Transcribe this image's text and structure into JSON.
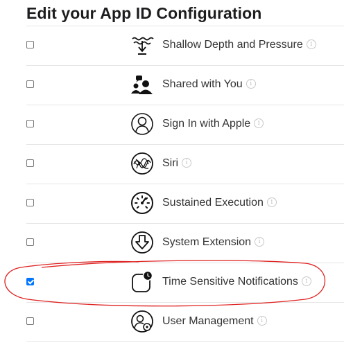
{
  "page_title": "Edit your App ID Configuration",
  "info_glyph": "i",
  "annotation_color": "#e02020",
  "checkbox_checked_color": "#0075ff",
  "capabilities": [
    {
      "label": "Shallow Depth and Pressure",
      "checked": false,
      "icon": "depth-pressure-icon"
    },
    {
      "label": "Shared with You",
      "checked": false,
      "icon": "shared-with-you-icon"
    },
    {
      "label": "Sign In with Apple",
      "checked": false,
      "icon": "sign-in-with-apple-icon"
    },
    {
      "label": "Siri",
      "checked": false,
      "icon": "siri-icon"
    },
    {
      "label": "Sustained Execution",
      "checked": false,
      "icon": "gauge-icon"
    },
    {
      "label": "System Extension",
      "checked": false,
      "icon": "system-extension-icon"
    },
    {
      "label": "Time Sensitive Notifications",
      "checked": true,
      "icon": "time-sensitive-notifications-icon"
    },
    {
      "label": "User Management",
      "checked": false,
      "icon": "user-management-icon"
    }
  ]
}
